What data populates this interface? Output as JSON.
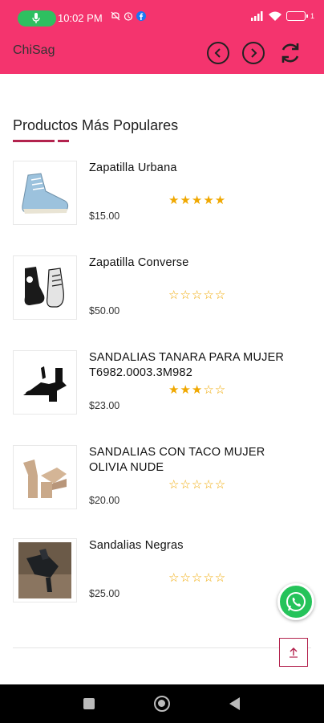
{
  "status_bar": {
    "time": "10:02 PM",
    "battery": "1",
    "icons": [
      "mic-icon",
      "mute-icon",
      "alarm-icon",
      "facebook-icon",
      "signal-icon",
      "wifi-icon",
      "battery-icon"
    ]
  },
  "app_bar": {
    "title": "ChiSag",
    "background": "#f4346e",
    "icons": [
      "chevron-left-icon",
      "chevron-right-icon",
      "refresh-icon"
    ]
  },
  "section": {
    "title": "Productos Más Populares",
    "accent": "#b3234e"
  },
  "products": [
    {
      "name": "Zapatilla Urbana",
      "price": "$15.00",
      "rating": 5,
      "stars": "★★★★★",
      "image": "sneaker-icon"
    },
    {
      "name": "Zapatilla Converse",
      "price": "$50.00",
      "rating": 0,
      "stars": "☆☆☆☆☆",
      "image": "converse-icon"
    },
    {
      "name": "SANDALIAS TANARA PARA MUJER T6982.0003.3M982",
      "price": "$23.00",
      "rating": 3,
      "stars": "★★★☆☆",
      "image": "sandal-black-icon"
    },
    {
      "name": "SANDALIAS CON TACO MUJER OLIVIA NUDE",
      "price": "$20.00",
      "rating": 0,
      "stars": "☆☆☆☆☆",
      "image": "sandal-nude-icon"
    },
    {
      "name": "Sandalias Negras",
      "price": "$25.00",
      "rating": 0,
      "stars": "☆☆☆☆☆",
      "image": "sandal-negra-icon"
    }
  ],
  "fab": {
    "whatsapp": "whatsapp-icon",
    "scroll_top": "arrow-up-icon"
  },
  "colors": {
    "star": "#f0a800",
    "whatsapp": "#25c35a",
    "status_bar": "#f4346e"
  }
}
